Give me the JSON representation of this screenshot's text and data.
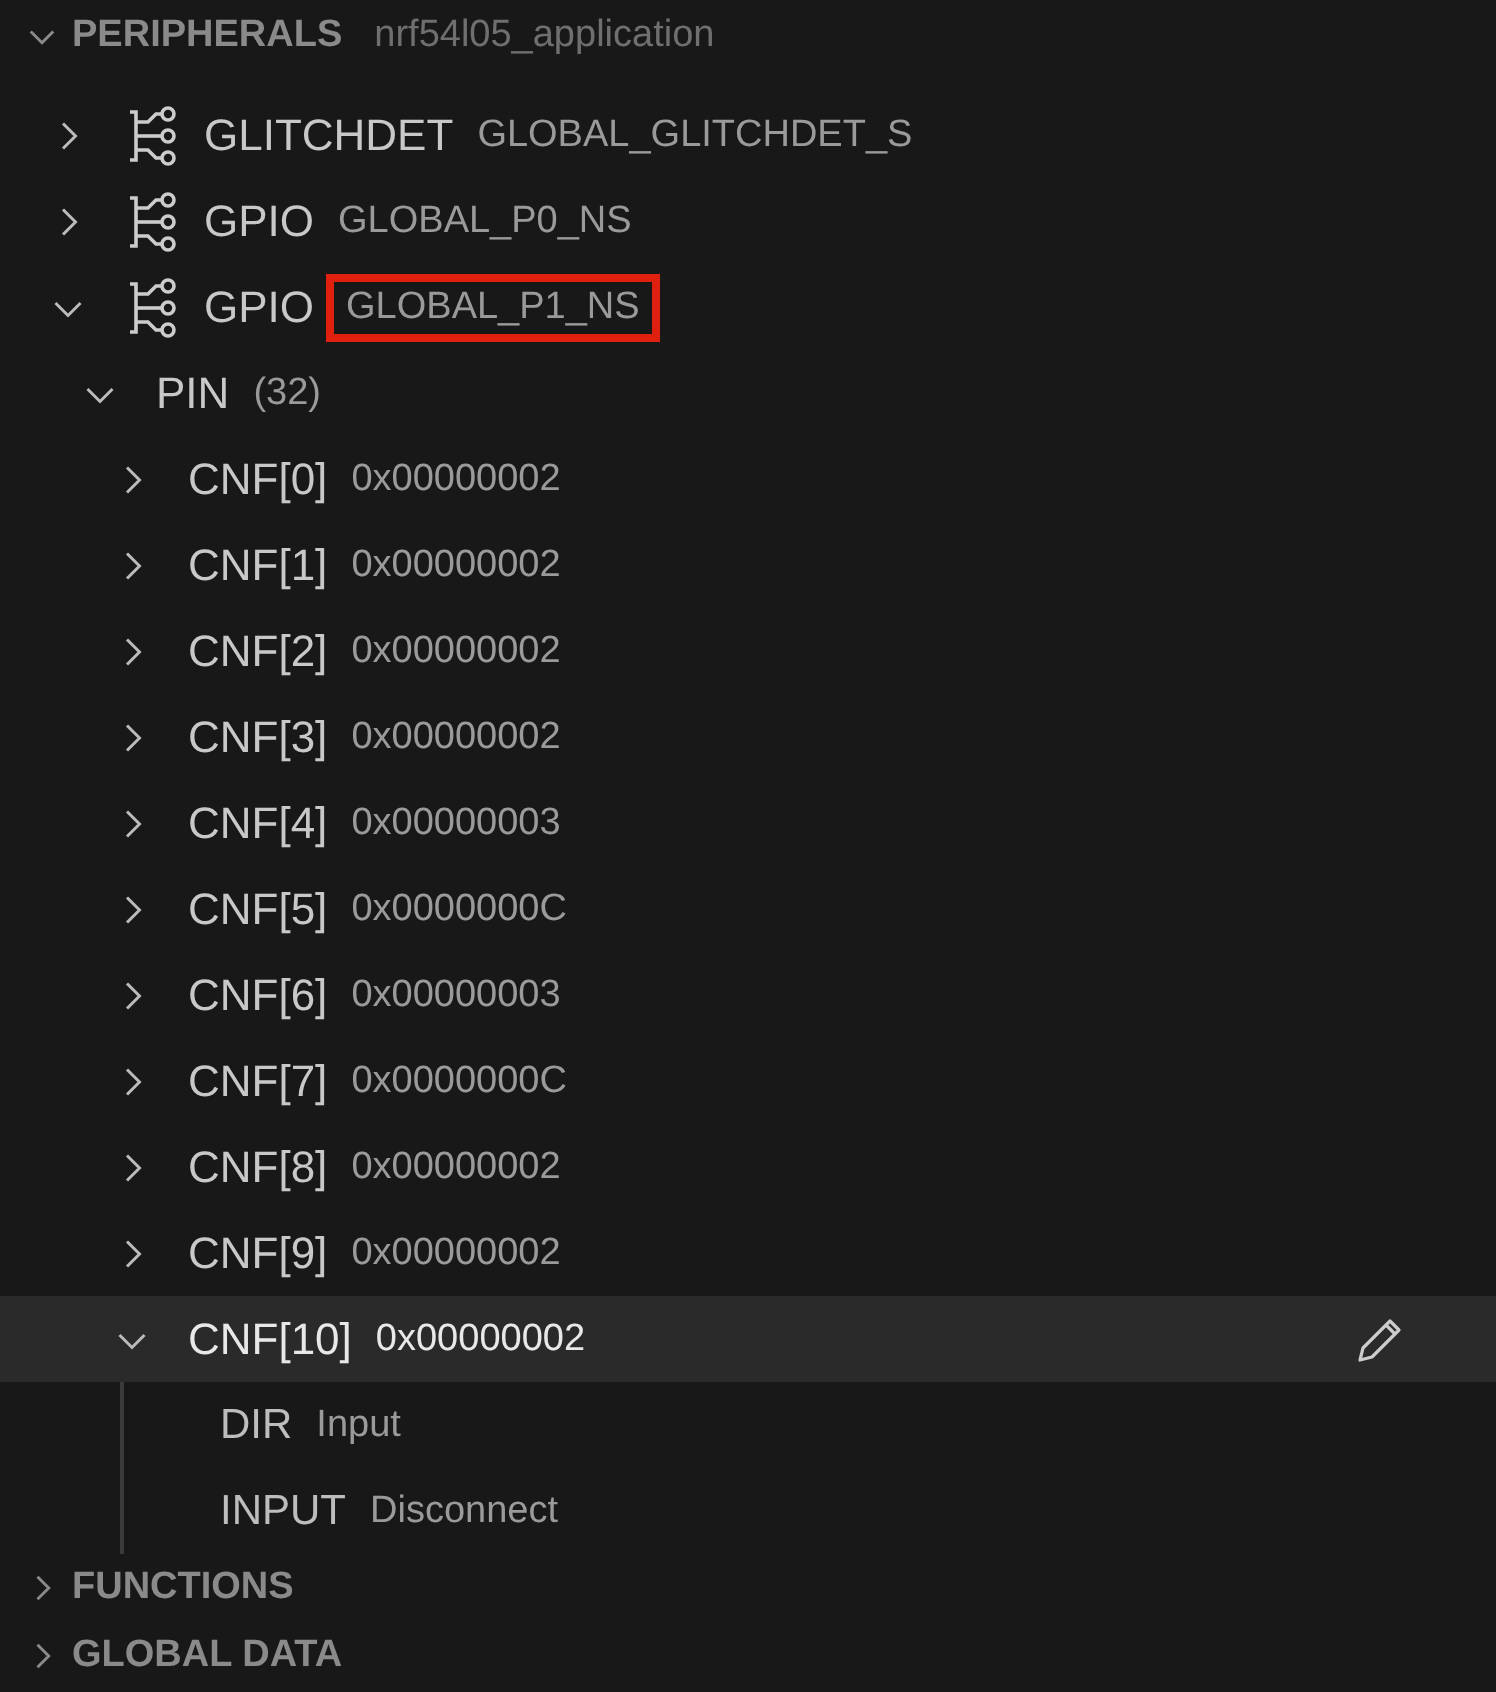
{
  "sections": [
    {
      "title": "PERIPHERALS",
      "subtitle": "nrf54l05_application",
      "expanded": true,
      "items": [
        {
          "name": "GLITCHDET",
          "value": "GLOBAL_GLITCHDET_S",
          "expanded": false,
          "highlighted": false
        },
        {
          "name": "GPIO",
          "value": "GLOBAL_P0_NS",
          "expanded": false,
          "highlighted": false
        },
        {
          "name": "GPIO",
          "value": "GLOBAL_P1_NS",
          "expanded": true,
          "highlighted": true,
          "children": [
            {
              "name": "PIN",
              "value": "(32)",
              "expanded": true,
              "children": [
                {
                  "name": "CNF[0]",
                  "value": "0x00000002",
                  "expanded": false,
                  "selected": false
                },
                {
                  "name": "CNF[1]",
                  "value": "0x00000002",
                  "expanded": false,
                  "selected": false
                },
                {
                  "name": "CNF[2]",
                  "value": "0x00000002",
                  "expanded": false,
                  "selected": false
                },
                {
                  "name": "CNF[3]",
                  "value": "0x00000002",
                  "expanded": false,
                  "selected": false
                },
                {
                  "name": "CNF[4]",
                  "value": "0x00000003",
                  "expanded": false,
                  "selected": false
                },
                {
                  "name": "CNF[5]",
                  "value": "0x0000000C",
                  "expanded": false,
                  "selected": false
                },
                {
                  "name": "CNF[6]",
                  "value": "0x00000003",
                  "expanded": false,
                  "selected": false
                },
                {
                  "name": "CNF[7]",
                  "value": "0x0000000C",
                  "expanded": false,
                  "selected": false
                },
                {
                  "name": "CNF[8]",
                  "value": "0x00000002",
                  "expanded": false,
                  "selected": false
                },
                {
                  "name": "CNF[9]",
                  "value": "0x00000002",
                  "expanded": false,
                  "selected": false
                },
                {
                  "name": "CNF[10]",
                  "value": "0x00000002",
                  "expanded": true,
                  "selected": true,
                  "children": [
                    {
                      "name": "DIR",
                      "value": "Input"
                    },
                    {
                      "name": "INPUT",
                      "value": "Disconnect"
                    }
                  ]
                }
              ]
            }
          ]
        }
      ]
    },
    {
      "title": "FUNCTIONS",
      "expanded": false
    },
    {
      "title": "GLOBAL DATA",
      "expanded": false
    }
  ]
}
